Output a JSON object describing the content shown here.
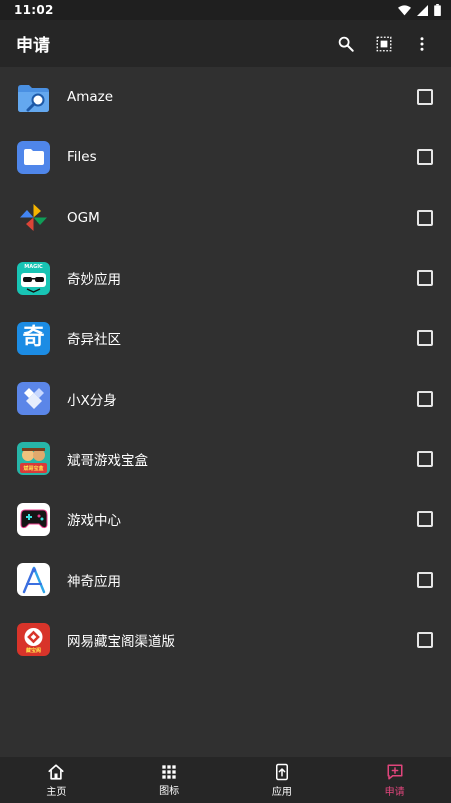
{
  "status": {
    "time": "11:02",
    "icons": [
      "wifi-icon",
      "signal-icon",
      "battery-icon"
    ]
  },
  "header": {
    "title": "申请",
    "actions": [
      "search-icon",
      "select-all-icon",
      "more-vert-icon"
    ]
  },
  "apps": [
    {
      "name": "Amaze",
      "icon": "amaze-icon",
      "checked": false
    },
    {
      "name": "Files",
      "icon": "files-icon",
      "checked": false
    },
    {
      "name": "OGM",
      "icon": "ogm-icon",
      "checked": false
    },
    {
      "name": "奇妙应用",
      "icon": "qimiao-icon",
      "checked": false
    },
    {
      "name": "奇异社区",
      "icon": "qiyi-icon",
      "checked": false
    },
    {
      "name": "小X分身",
      "icon": "xiaox-icon",
      "checked": false
    },
    {
      "name": "斌哥游戏宝盒",
      "icon": "binge-icon",
      "checked": false
    },
    {
      "name": "游戏中心",
      "icon": "game-center-icon",
      "checked": false
    },
    {
      "name": "神奇应用",
      "icon": "shenqi-icon",
      "checked": false
    },
    {
      "name": "网易藏宝阁渠道版",
      "icon": "cangbaoge-icon",
      "checked": false
    }
  ],
  "icon_badges": {
    "qimiao": "MAGIC",
    "qiyi": "奇",
    "binge": "斌哥宝盒",
    "cangbaoge": "藏宝阁"
  },
  "nav": {
    "items": [
      {
        "label": "主页",
        "icon": "home-icon"
      },
      {
        "label": "图标",
        "icon": "grid-icon"
      },
      {
        "label": "应用",
        "icon": "app-upload-icon"
      },
      {
        "label": "申请",
        "icon": "request-icon"
      }
    ],
    "active_index": 3
  },
  "colors": {
    "background": "#303030",
    "bar": "#262626",
    "status_bar": "#1f1f1f",
    "accent": "#e0457c",
    "text": "#ffffff"
  }
}
